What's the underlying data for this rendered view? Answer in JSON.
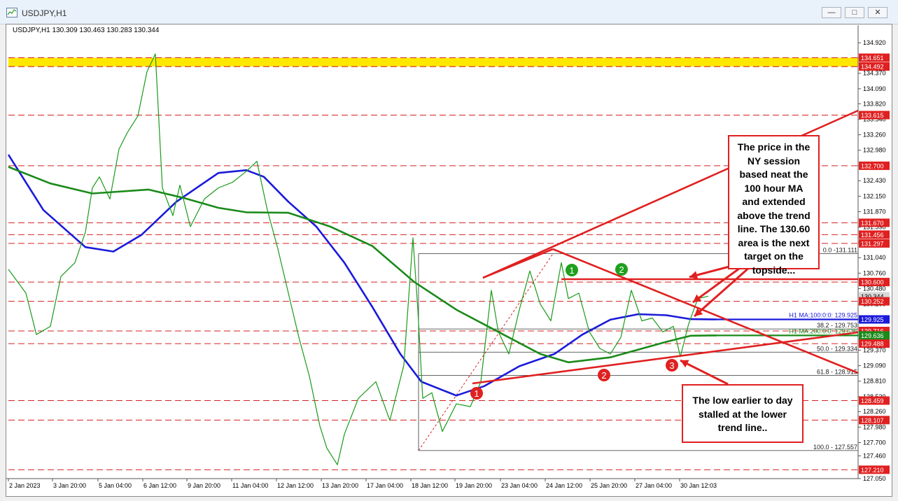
{
  "window": {
    "title": "USDJPY,H1",
    "controls": [
      "—",
      "□",
      "✕"
    ]
  },
  "ohlc_label": "USDJPY,H1  130.309 130.463 130.283 130.344",
  "callouts": {
    "top": [
      "The price in the",
      "NY session",
      "based neat the",
      "100 hour MA",
      "and extended",
      "above the trend",
      "line. The 130.60",
      "area is the next",
      "target on the",
      "topside..."
    ],
    "bottom": [
      "The low earlier to day",
      "stalled at the lower",
      "trend line.."
    ]
  },
  "markers": [
    {
      "label": "1",
      "color": "#e02020",
      "series": "lower-trend"
    },
    {
      "label": "2",
      "color": "#e02020",
      "series": "lower-trend"
    },
    {
      "label": "3",
      "color": "#e02020",
      "series": "lower-trend"
    },
    {
      "label": "1",
      "color": "#1ea01e",
      "series": "resistance"
    },
    {
      "label": "2",
      "color": "#1ea01e",
      "series": "resistance"
    }
  ],
  "chart_data": {
    "type": "line",
    "symbol": "USDJPY",
    "timeframe": "H1",
    "ylim": [
      127.05,
      135.15
    ],
    "y_ticks": [
      "134.920",
      "134.650",
      "134.370",
      "134.090",
      "133.820",
      "133.540",
      "133.260",
      "132.980",
      "132.700",
      "132.430",
      "132.150",
      "131.870",
      "131.590",
      "131.310",
      "131.040",
      "130.760",
      "130.480",
      "130.200",
      "129.925",
      "129.640",
      "129.370",
      "129.090",
      "128.810",
      "128.530",
      "128.260",
      "127.980",
      "127.700",
      "127.460",
      "127.050"
    ],
    "x_ticks": [
      "2 Jan 2023",
      "3 Jan 20:00",
      "5 Jan 04:00",
      "6 Jan 12:00",
      "9 Jan 20:00",
      "11 Jan 04:00",
      "12 Jan 12:00",
      "13 Jan 20:00",
      "17 Jan 04:00",
      "18 Jan 12:00",
      "19 Jan 20:00",
      "23 Jan 04:00",
      "24 Jan 12:00",
      "25 Jan 20:00",
      "27 Jan 04:00",
      "30 Jan 12:03"
    ],
    "price_labels": [
      {
        "value": 134.651,
        "text": "134.651",
        "style": "red"
      },
      {
        "value": 134.492,
        "text": "134.492",
        "style": "red"
      },
      {
        "value": 133.615,
        "text": "133.615",
        "style": "red"
      },
      {
        "value": 132.7,
        "text": "132.700",
        "style": "red"
      },
      {
        "value": 131.67,
        "text": "131.670",
        "style": "red"
      },
      {
        "value": 131.456,
        "text": "131.456",
        "style": "red"
      },
      {
        "value": 131.297,
        "text": "131.297",
        "style": "red"
      },
      {
        "value": 130.6,
        "text": "130.600",
        "style": "red"
      },
      {
        "value": 130.344,
        "text": "130.344",
        "style": "gray"
      },
      {
        "value": 130.252,
        "text": "130.252",
        "style": "red"
      },
      {
        "value": 129.925,
        "text": "129.925",
        "style": "blue"
      },
      {
        "value": 129.716,
        "text": "129.716",
        "style": "red"
      },
      {
        "value": 129.636,
        "text": "129.636",
        "style": "green"
      },
      {
        "value": 129.488,
        "text": "129.488",
        "style": "red"
      },
      {
        "value": 128.459,
        "text": "128.459",
        "style": "red"
      },
      {
        "value": 128.107,
        "text": "128.107",
        "style": "red"
      },
      {
        "value": 127.21,
        "text": "127.210",
        "style": "red"
      }
    ],
    "fib_levels": [
      {
        "label": "0.0 -131.111",
        "value": 131.111
      },
      {
        "label": "38.2 - 129.753",
        "value": 129.753
      },
      {
        "label": "50.0 - 129.334",
        "value": 129.334
      },
      {
        "label": "61.8 - 128.915",
        "value": 128.915
      },
      {
        "label": "100.0 - 127.557",
        "value": 127.557
      }
    ],
    "ma_labels": [
      {
        "text": "H1 MA:100:0:0: 129.925",
        "value": 129.925,
        "color": "#1a1adb"
      },
      {
        "text": "H1 MA:200:0:0: 129.636",
        "value": 129.636,
        "color": "#1a8a1a"
      }
    ],
    "series": [
      {
        "name": "H1 MA:100",
        "color": "#1a1adb",
        "points": [
          [
            0,
            132.9
          ],
          [
            50,
            131.9
          ],
          [
            110,
            131.23
          ],
          [
            150,
            131.15
          ],
          [
            190,
            131.45
          ],
          [
            240,
            132.05
          ],
          [
            300,
            132.57
          ],
          [
            340,
            132.62
          ],
          [
            365,
            132.5
          ],
          [
            400,
            132.05
          ],
          [
            440,
            131.6
          ],
          [
            480,
            130.95
          ],
          [
            520,
            130.15
          ],
          [
            560,
            129.3
          ],
          [
            590,
            128.8
          ],
          [
            640,
            128.55
          ],
          [
            680,
            128.72
          ],
          [
            730,
            129.08
          ],
          [
            780,
            129.3
          ],
          [
            820,
            129.65
          ],
          [
            860,
            129.92
          ],
          [
            900,
            130.02
          ],
          [
            940,
            130.0
          ],
          [
            975,
            129.93
          ],
          [
            1012,
            129.925
          ]
        ]
      },
      {
        "name": "H1 MA:200",
        "color": "#1a8a1a",
        "points": [
          [
            0,
            132.68
          ],
          [
            60,
            132.38
          ],
          [
            120,
            132.2
          ],
          [
            200,
            132.27
          ],
          [
            250,
            132.12
          ],
          [
            300,
            131.94
          ],
          [
            340,
            131.86
          ],
          [
            400,
            131.85
          ],
          [
            460,
            131.6
          ],
          [
            520,
            131.25
          ],
          [
            580,
            130.6
          ],
          [
            640,
            130.1
          ],
          [
            700,
            129.7
          ],
          [
            760,
            129.3
          ],
          [
            800,
            129.15
          ],
          [
            860,
            129.24
          ],
          [
            900,
            129.38
          ],
          [
            940,
            129.52
          ],
          [
            975,
            129.63
          ],
          [
            1012,
            129.636
          ]
        ]
      },
      {
        "name": "USDJPY close",
        "color": "#1a9a1a",
        "points": [
          [
            0,
            130.83
          ],
          [
            25,
            130.4
          ],
          [
            40,
            129.65
          ],
          [
            60,
            129.8
          ],
          [
            75,
            130.7
          ],
          [
            95,
            130.95
          ],
          [
            110,
            131.5
          ],
          [
            120,
            132.3
          ],
          [
            130,
            132.5
          ],
          [
            145,
            132.1
          ],
          [
            158,
            133.0
          ],
          [
            170,
            133.3
          ],
          [
            185,
            133.6
          ],
          [
            198,
            134.4
          ],
          [
            210,
            134.72
          ],
          [
            220,
            132.3
          ],
          [
            235,
            131.8
          ],
          [
            245,
            132.35
          ],
          [
            260,
            131.6
          ],
          [
            280,
            132.1
          ],
          [
            300,
            132.3
          ],
          [
            320,
            132.4
          ],
          [
            340,
            132.6
          ],
          [
            355,
            132.78
          ],
          [
            370,
            131.9
          ],
          [
            385,
            131.2
          ],
          [
            400,
            130.4
          ],
          [
            415,
            129.6
          ],
          [
            430,
            128.9
          ],
          [
            445,
            128.0
          ],
          [
            455,
            127.6
          ],
          [
            470,
            127.3
          ],
          [
            480,
            127.85
          ],
          [
            500,
            128.5
          ],
          [
            525,
            128.8
          ],
          [
            545,
            128.1
          ],
          [
            565,
            129.1
          ],
          [
            578,
            131.4
          ],
          [
            585,
            130.1
          ],
          [
            592,
            128.5
          ],
          [
            605,
            128.6
          ],
          [
            620,
            127.9
          ],
          [
            640,
            128.4
          ],
          [
            660,
            128.35
          ],
          [
            675,
            128.8
          ],
          [
            690,
            130.45
          ],
          [
            700,
            129.7
          ],
          [
            715,
            129.3
          ],
          [
            730,
            130.1
          ],
          [
            745,
            130.8
          ],
          [
            760,
            130.2
          ],
          [
            775,
            129.9
          ],
          [
            790,
            130.95
          ],
          [
            800,
            130.3
          ],
          [
            815,
            130.4
          ],
          [
            830,
            129.7
          ],
          [
            845,
            129.4
          ],
          [
            860,
            129.3
          ],
          [
            875,
            129.6
          ],
          [
            890,
            130.45
          ],
          [
            905,
            129.9
          ],
          [
            920,
            129.95
          ],
          [
            935,
            129.7
          ],
          [
            950,
            129.8
          ],
          [
            960,
            129.25
          ],
          [
            972,
            129.85
          ],
          [
            985,
            130.3
          ],
          [
            1000,
            130.344
          ]
        ]
      }
    ]
  }
}
